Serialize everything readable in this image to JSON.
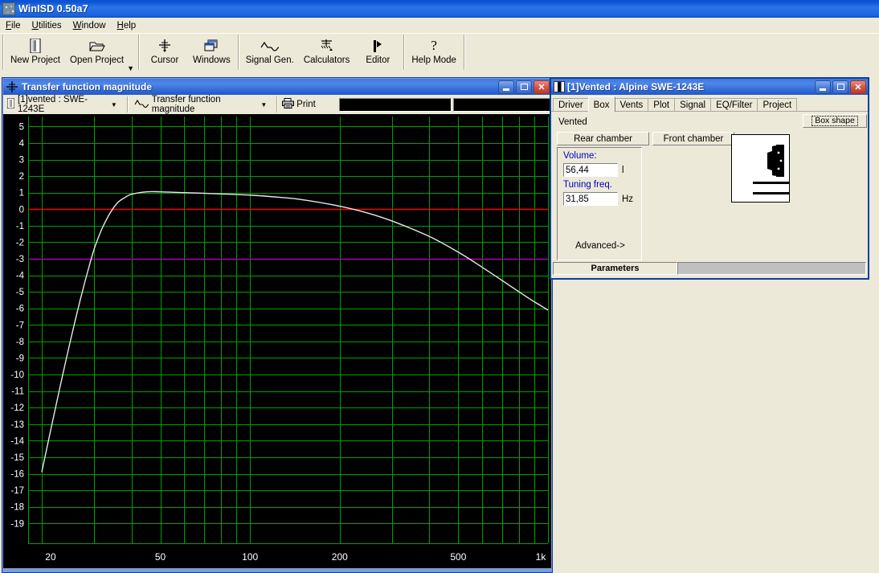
{
  "app": {
    "title": "WinISD 0.50a7",
    "icon": "app-icon",
    "menu": [
      "File",
      "Utilities",
      "Window",
      "Help"
    ],
    "toolbar": [
      {
        "label": "New Project",
        "icon": "new-project-icon",
        "dropdown": false
      },
      {
        "label": "Open Project",
        "icon": "open-folder-icon",
        "dropdown": true
      },
      {
        "label": "Cursor",
        "icon": "crosshair-icon",
        "dropdown": false
      },
      {
        "label": "Windows",
        "icon": "windows-cascade-icon",
        "dropdown": false
      },
      {
        "label": "Signal Gen.",
        "icon": "waveform-icon",
        "dropdown": false
      },
      {
        "label": "Calculators",
        "icon": "calculator-icon",
        "dropdown": false
      },
      {
        "label": "Editor",
        "icon": "editor-icon",
        "dropdown": false
      },
      {
        "label": "Help Mode",
        "icon": "question-mark-icon",
        "dropdown": false
      }
    ]
  },
  "chart_window": {
    "title": "Transfer function magnitude",
    "icon": "crosshair-icon",
    "buttons": {
      "minimize": "_",
      "maximize": "□",
      "close": "✕"
    },
    "toolbar": {
      "project_combo": "[1]vented : SWE-1243E",
      "project_combo_icon": "project-icon",
      "plot_combo": "Transfer function magnitude",
      "plot_combo_icon": "waveform-icon",
      "print_label": "Print",
      "print_icon": "printer-icon",
      "readout_1": "",
      "readout_2": ""
    }
  },
  "chart_data": {
    "type": "line",
    "title": "Transfer function magnitude",
    "xlabel": "",
    "ylabel": "",
    "xscale": "log",
    "xlim": [
      18,
      1000
    ],
    "ylim": [
      -20.2,
      5.6
    ],
    "xticks": [
      20,
      50,
      100,
      200,
      500,
      1000
    ],
    "xticklabels": [
      "20",
      "50",
      "100",
      "200",
      "500",
      "1k"
    ],
    "yticks": [
      5,
      4,
      3,
      2,
      1,
      0,
      -1,
      -2,
      -3,
      -4,
      -5,
      -6,
      -7,
      -8,
      -9,
      -10,
      -11,
      -12,
      -13,
      -14,
      -15,
      -16,
      -17,
      -18,
      -19
    ],
    "grid": true,
    "grid_color": "#00a000",
    "bg_color": "#000000",
    "axis_text_color": "#ffffff",
    "reference_lines": [
      {
        "value": 0,
        "color": "#ff0000",
        "name": "0 dB reference"
      },
      {
        "value": -3,
        "color": "#b000b0",
        "name": "-3 dB reference"
      }
    ],
    "series": [
      {
        "name": "Transfer function magnitude",
        "color": "#e8e8e8",
        "x": [
          20,
          21,
          22,
          23,
          24,
          25,
          26,
          27,
          28,
          29,
          30,
          31,
          32,
          34,
          36,
          38,
          40,
          45,
          50,
          60,
          70,
          80,
          100,
          125,
          150,
          200,
          250,
          300,
          400,
          500,
          600,
          700,
          800,
          900,
          1000
        ],
        "y": [
          -15.9,
          -14.1,
          -12.4,
          -10.8,
          -9.3,
          -7.9,
          -6.6,
          -5.4,
          -4.3,
          -3.3,
          -2.4,
          -1.7,
          -1.1,
          -0.2,
          0.4,
          0.7,
          0.9,
          1.05,
          1.05,
          1.0,
          0.96,
          0.92,
          0.85,
          0.72,
          0.57,
          0.18,
          -0.25,
          -0.72,
          -1.65,
          -2.6,
          -3.5,
          -4.3,
          -5.0,
          -5.6,
          -6.1
        ]
      }
    ]
  },
  "param_window": {
    "title": "[1]Vented : Alpine SWE-1243E",
    "icon": "project-icon",
    "buttons": {
      "minimize": "_",
      "maximize": "□",
      "close": "✕"
    },
    "tabs": [
      {
        "label": "Driver",
        "selected": false
      },
      {
        "label": "Box",
        "selected": true
      },
      {
        "label": "Vents",
        "selected": false
      },
      {
        "label": "Plot",
        "selected": false
      },
      {
        "label": "Signal",
        "selected": false
      },
      {
        "label": "EQ/Filter",
        "selected": false
      },
      {
        "label": "Project",
        "selected": false
      }
    ],
    "box_tab": {
      "box_type": "Vented",
      "box_shape_button": "Box shape",
      "rear_chamber_button": "Rear chamber",
      "front_chamber_button": "Front chamber",
      "volume_label": "Volume:",
      "volume_value": "56,44",
      "volume_unit": "l",
      "tuning_label": "Tuning freq.",
      "tuning_value": "31,85",
      "tuning_unit": "Hz",
      "advanced_label": "Advanced->",
      "box_picture": "vented-box-diagram"
    },
    "status": {
      "left": "Parameters",
      "right": ""
    }
  }
}
